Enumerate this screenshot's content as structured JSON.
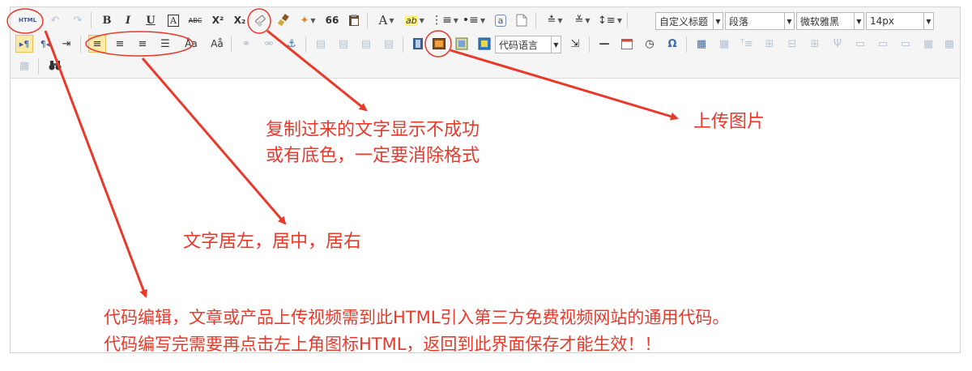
{
  "toolbar": {
    "html_button": "HTML",
    "heading_select": "自定义标题",
    "paragraph_select": "段落",
    "font_family_select": "微软雅黑",
    "font_size_select": "14px",
    "code_language_select": "代码语言",
    "bold": "B",
    "italic": "I",
    "underline": "U",
    "frame_text": "A",
    "strike": "ABC",
    "superscript": "X²",
    "subscript": "X₂",
    "quote": "66",
    "font_color": "A",
    "letter_a": "a",
    "omega": "Ω",
    "hr": "—"
  },
  "annotations": {
    "clear_format": [
      "复制过来的文字显示不成功",
      "或有底色，一定要消除格式"
    ],
    "upload_image": "上传图片",
    "align": "文字居左，居中，居右",
    "code_edit": [
      "代码编辑，文章或产品上传视频需到此HTML引入第三方免费视频网站的通用代码。",
      "代码编写完需要再点击左上角图标HTML，返回到此界面保存才能生效！！"
    ]
  },
  "colors": {
    "annotation": "#e8392b",
    "toolbar_bg": "#f5f5f5",
    "active_bg": "#fde9a8"
  }
}
